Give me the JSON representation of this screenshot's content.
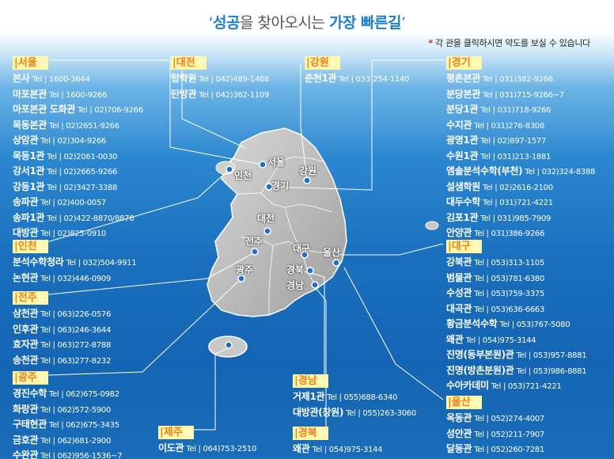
{
  "title": {
    "q_open": "‘",
    "part1": "성공",
    "part2": "을 찾아오시는 ",
    "part3": "가장 빠른길",
    "q_close": "’"
  },
  "note": {
    "star": "*",
    "text": " 각 관을 클릭하시면 약도를 보실 수 있습니다"
  },
  "map_labels": [
    "서울",
    "인천",
    "경기",
    "강원",
    "대전",
    "전주",
    "광주",
    "대구",
    "울산",
    "경북",
    "경남"
  ],
  "regions": {
    "seoul": {
      "label": "서울",
      "branches": [
        {
          "name": "본사",
          "tel": "Tel | 1600-3644"
        },
        {
          "name": "마포본관",
          "tel": "Tel | 1600-9266"
        },
        {
          "name": "마포본관 도화관",
          "tel": "Tel | 02)706-9266"
        },
        {
          "name": "목동본관",
          "tel": "Tel | 02)2651-9266"
        },
        {
          "name": "상암관",
          "tel": "Tel | 02)304-9266"
        },
        {
          "name": "목동1관",
          "tel": "Tel | 02)2061-0030"
        },
        {
          "name": "강서1관",
          "tel": "Tel | 02)2665-9266"
        },
        {
          "name": "강동1관",
          "tel": "Tel | 02)3427-3388"
        },
        {
          "name": "송파관",
          "tel": "Tel | 02)400-0057"
        },
        {
          "name": "송파1관",
          "tel": "Tel | 02)422-8870/8876"
        },
        {
          "name": "대방관",
          "tel": "Tel | 02)825-0910"
        }
      ]
    },
    "incheon": {
      "label": "인천",
      "branches": [
        {
          "name": "분석수학청라",
          "tel": "Tel | 032)504-9911"
        },
        {
          "name": "논현관",
          "tel": "Tel | 032)446-0909"
        }
      ]
    },
    "jeonju": {
      "label": "전주",
      "branches": [
        {
          "name": "삼천관",
          "tel": "Tel | 063)226-0576"
        },
        {
          "name": "인후관",
          "tel": "Tel | 063)246-3644"
        },
        {
          "name": "효자관",
          "tel": "Tel | 063)272-8788"
        },
        {
          "name": "송천관",
          "tel": "Tel | 063)277-8232"
        }
      ]
    },
    "gwangju": {
      "label": "광주",
      "branches": [
        {
          "name": "경진수학",
          "tel": "Tel | 062)675-0982"
        },
        {
          "name": "화랑관",
          "tel": "Tel | 062)572-5900"
        },
        {
          "name": "구태현관",
          "tel": "Tel | 062)675-3435"
        },
        {
          "name": "금호관",
          "tel": "Tel | 062)681-2900"
        },
        {
          "name": "수완관",
          "tel": "Tel | 062)956-1536~7"
        }
      ]
    },
    "daejeon": {
      "label": "대전",
      "branches": [
        {
          "name": "탑학원",
          "tel": "Tel | 042)489-1468"
        },
        {
          "name": "탄방관",
          "tel": "Tel | 042)362-1109"
        }
      ]
    },
    "gangwon": {
      "label": "강원",
      "branches": [
        {
          "name": "춘천1관",
          "tel": "Tel | 033)254-1140"
        }
      ]
    },
    "jeju": {
      "label": "제주",
      "branches": [
        {
          "name": "이도관",
          "tel": "Tel | 064)753-2510"
        }
      ]
    },
    "gyeongnam": {
      "label": "경남",
      "branches": [
        {
          "name": "거제1관",
          "tel": "Tel | 055)688-6340"
        },
        {
          "name": "대방관(창원)",
          "tel": "Tel | 055)263-3060"
        }
      ]
    },
    "gyeongbuk": {
      "label": "경북",
      "branches": [
        {
          "name": "왜관",
          "tel": "Tel | 054)975-3144"
        }
      ]
    },
    "gyeonggi": {
      "label": "경기",
      "branches": [
        {
          "name": "평촌본관",
          "tel": "Tel | 031)382-9266"
        },
        {
          "name": "분당본관",
          "tel": "Tel | 031)715-9266~7"
        },
        {
          "name": "분당1관",
          "tel": "Tel | 031)718-9266"
        },
        {
          "name": "수지관",
          "tel": "Tel | 031)276-8308"
        },
        {
          "name": "광명1관",
          "tel": "Tel | 02)897-1577"
        },
        {
          "name": "수원1관",
          "tel": "Tel | 031)213-1881"
        },
        {
          "name": "엠솔분석수학(부천)",
          "tel": "Tel | 032)324-8388"
        },
        {
          "name": "설샘학원",
          "tel": "Tel | 02)2616-2100"
        },
        {
          "name": "대두수학",
          "tel": "Tel | 031)721-4221"
        },
        {
          "name": "김포1관",
          "tel": "Tel | 031)985-7909"
        },
        {
          "name": "안양관",
          "tel": "Tel | 031)386-9266"
        }
      ]
    },
    "daegu": {
      "label": "대구",
      "branches": [
        {
          "name": "강북관",
          "tel": "Tel | 053)313-1105"
        },
        {
          "name": "범물관",
          "tel": "Tel | 053)781-6380"
        },
        {
          "name": "수성관",
          "tel": "Tel | 053)759-3375"
        },
        {
          "name": "대곡관",
          "tel": "Tel | 053)636-6663"
        },
        {
          "name": "황금분석수학",
          "tel": "Tel | 053)767-5080"
        },
        {
          "name": "왜관",
          "tel": "Tel | 054)975-3144"
        },
        {
          "name": "진명(동부본원)관",
          "tel": "Tel | 053)957-8881"
        },
        {
          "name": "진명(방촌분원)관",
          "tel": "Tel | 053)986-8881"
        },
        {
          "name": "수아카데미",
          "tel": "Tel | 053)721-4221"
        }
      ]
    },
    "ulsan": {
      "label": "울산",
      "branches": [
        {
          "name": "옥동관",
          "tel": "Tel | 052)274-4007"
        },
        {
          "name": "성안관",
          "tel": "Tel | 052)211-7907"
        },
        {
          "name": "달동관",
          "tel": "Tel | 052)260-7281"
        }
      ]
    }
  }
}
